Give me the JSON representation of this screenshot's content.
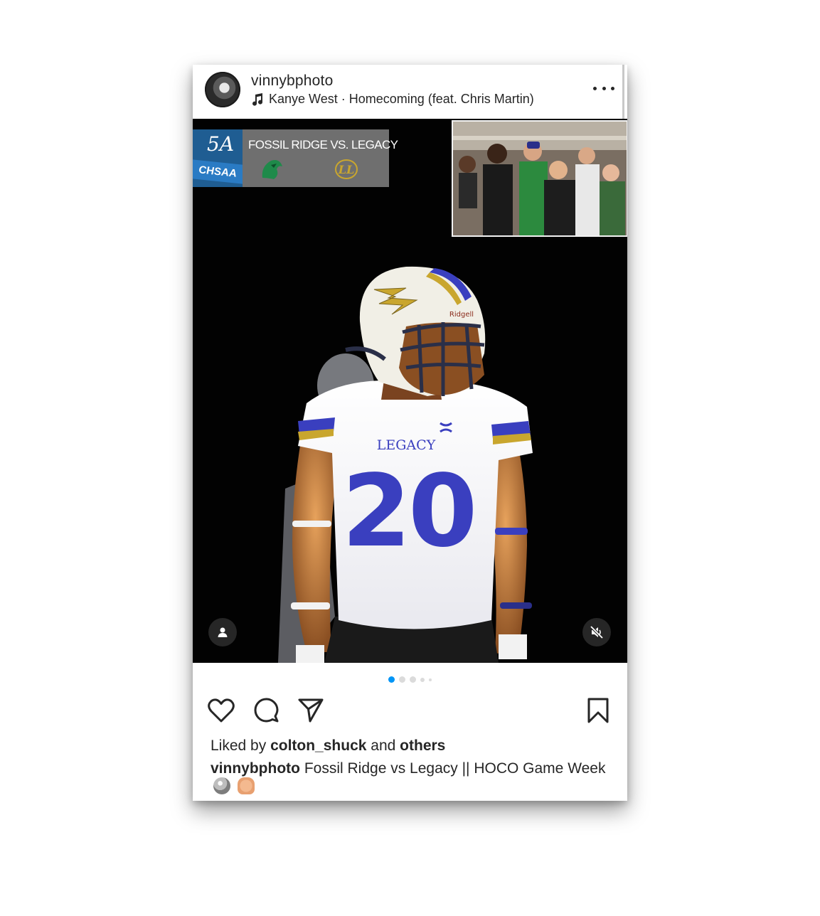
{
  "post": {
    "username": "vinnybphoto",
    "audio": "Kanye West · Homecoming (feat. Chris Martin)",
    "more_label": "More options"
  },
  "media": {
    "scorebug": {
      "classification": "5A",
      "association": "CHSAA",
      "matchup": "FOSSIL RIDGE VS. LEGACY"
    },
    "jersey_team": "LEGACY",
    "jersey_number": "20",
    "helmet_brand": "Ridgell",
    "carousel_total": 5,
    "carousel_active": 1
  },
  "actions": {
    "like": "heart-icon",
    "comment": "comment-icon",
    "share": "send-icon",
    "save": "bookmark-icon"
  },
  "likes": {
    "prefix": "Liked by",
    "user": "colton_shuck",
    "joiner": "and",
    "others": "others"
  },
  "caption": {
    "author": "vinnybphoto",
    "text": "Fossil Ridge vs Legacy || HOCO Game Week"
  },
  "colors": {
    "accent": "#0095f6",
    "text": "#262626",
    "jersey_blue": "#3a3fbf",
    "helmet_gold": "#c9a62e"
  }
}
